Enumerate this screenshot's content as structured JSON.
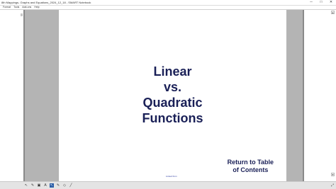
{
  "window": {
    "title": "8th Mappings- Graphs and Equations_2024_12_18 - SMART Notebook",
    "buttons": {
      "minimize": "─",
      "maximize": "□",
      "close": "✕"
    }
  },
  "menu": {
    "items": [
      "Format",
      "Tools",
      "Add-ons",
      "Help"
    ]
  },
  "slide": {
    "title_lines": [
      "Linear",
      "vs.",
      "Quadratic",
      "Functions"
    ],
    "return_line1": "Return to Table",
    "return_line2": "of Contents",
    "credits": "Linked from"
  },
  "taskbar": {
    "tools": [
      {
        "name": "select-tool",
        "glyph": "↖"
      },
      {
        "name": "pen-tool",
        "glyph": "✎"
      },
      {
        "name": "image-tool",
        "glyph": "▣"
      },
      {
        "name": "text-tool",
        "glyph": "A"
      },
      {
        "name": "pointer-tool",
        "glyph": "↖",
        "active": true
      },
      {
        "name": "pen-style-tool",
        "glyph": "✎"
      },
      {
        "name": "eraser-tool",
        "glyph": "◇"
      },
      {
        "name": "line-tool",
        "glyph": "╱"
      }
    ],
    "end_icon": "⤢"
  },
  "colors": {
    "title": "#1a2057",
    "page_gray": "#b4b4b4",
    "active_tool": "#2b5ea7"
  }
}
